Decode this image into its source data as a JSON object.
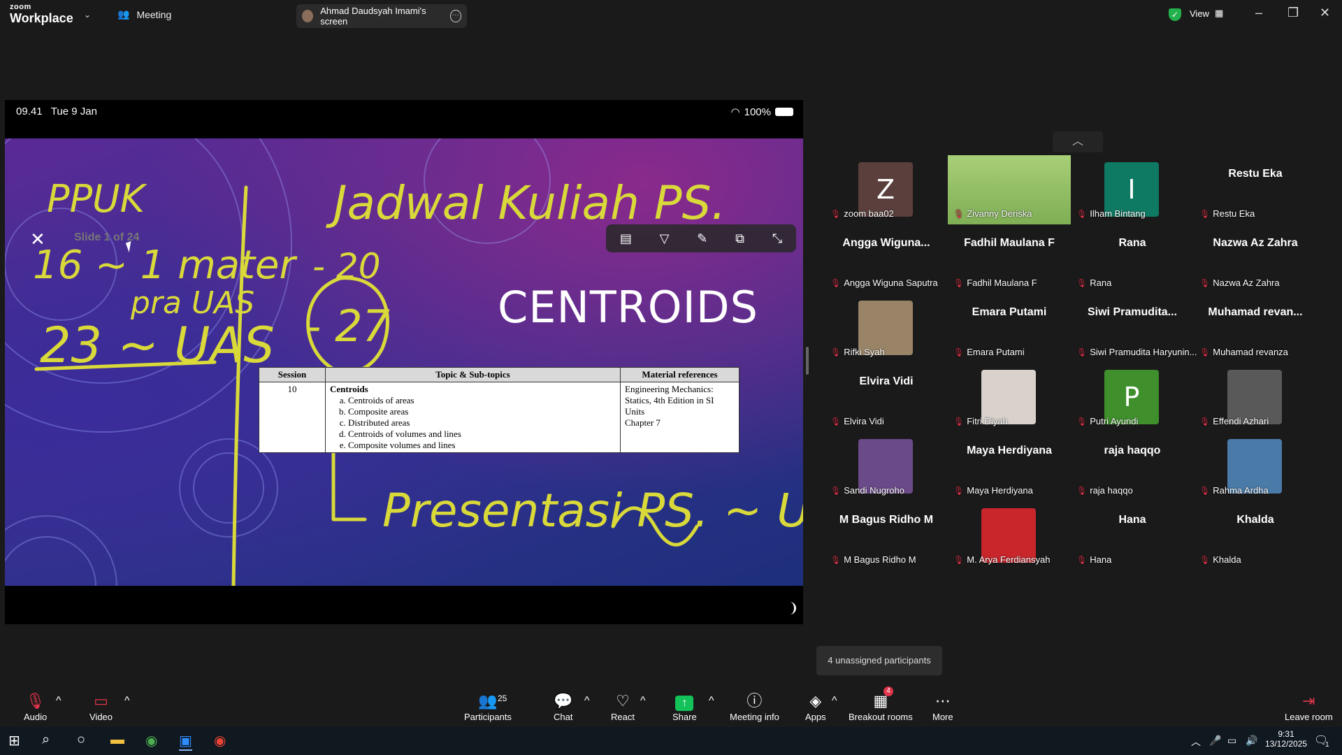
{
  "app": {
    "brand_line1": "zoom",
    "brand_line2": "Workplace",
    "meeting_tab": "Meeting",
    "screen_tab": "Ahmad Daudsyah Imami's screen",
    "view_label": "View"
  },
  "ipad": {
    "time": "09.41",
    "date": "Tue 9 Jan",
    "battery": "100%"
  },
  "slide": {
    "counter": "Slide 1 of 24",
    "title": "CENTROIDS",
    "table": {
      "headers": [
        "Session",
        "Topic & Sub-topics",
        "Material references"
      ],
      "session": "10",
      "topic": "Centroids",
      "subtopics": [
        "Centroids of areas",
        "Composite areas",
        "Distributed areas",
        "Centroids of volumes and lines",
        "Composite volumes and lines"
      ],
      "references": "Engineering Mechanics: Statics, 4th Edition in SI Units",
      "chapter": "Chapter 7"
    },
    "annotation_text": [
      "PPUK",
      "16 ~ 1 mater pra UAS",
      "23 ~ UAS",
      "Jadwal Kuliah PS.",
      "20",
      "27",
      "Presentasi PS. ~ UAS."
    ]
  },
  "participants": [
    {
      "display": "",
      "name": "zoom baa02",
      "letter": "Z",
      "color": "#5a3f3c",
      "kind": "letter"
    },
    {
      "display": "",
      "name": "Zivanny Deriska",
      "kind": "photo-wide",
      "color": "#7fae55"
    },
    {
      "display": "",
      "name": "Ilham Bintang",
      "letter": "I",
      "color": "#0f7a63",
      "kind": "letter"
    },
    {
      "display": "Restu Eka",
      "name": "Restu Eka",
      "kind": "text"
    },
    {
      "display": "Angga  Wiguna...",
      "name": "Angga Wiguna Saputra",
      "kind": "text"
    },
    {
      "display": "Fadhil Maulana F",
      "name": "Fadhil Maulana F",
      "kind": "text"
    },
    {
      "display": "Rana",
      "name": "Rana",
      "kind": "text"
    },
    {
      "display": "Nazwa Az Zahra",
      "name": "Nazwa Az Zahra",
      "kind": "text"
    },
    {
      "display": "",
      "name": "Rifki Syah",
      "kind": "photo",
      "color": "#9a8468"
    },
    {
      "display": "Emara Putami",
      "name": "Emara Putami",
      "kind": "text"
    },
    {
      "display": "Siwi  Pramudita...",
      "name": "Siwi Pramudita Haryunin...",
      "kind": "text"
    },
    {
      "display": "Muhamad  revan...",
      "name": "Muhamad revanza",
      "kind": "text"
    },
    {
      "display": "Elvira Vidi",
      "name": "Elvira Vidi",
      "kind": "text"
    },
    {
      "display": "",
      "name": "Fitri Diyah",
      "kind": "photo",
      "color": "#d9d2cc"
    },
    {
      "display": "",
      "name": "Putri Ayundi",
      "letter": "P",
      "color": "#3f8f2c",
      "kind": "letter"
    },
    {
      "display": "",
      "name": "Effendi Azhari",
      "kind": "photo",
      "color": "#595959"
    },
    {
      "display": "",
      "name": "Sandi Nugroho",
      "kind": "photo",
      "color": "#6b4a8a"
    },
    {
      "display": "Maya Herdiyana",
      "name": "Maya Herdiyana",
      "kind": "text"
    },
    {
      "display": "raja haqqo",
      "name": "raja haqqo",
      "kind": "text"
    },
    {
      "display": "",
      "name": "Rahma Ardha",
      "kind": "photo",
      "color": "#4a7aa8"
    },
    {
      "display": "M Bagus Ridho M",
      "name": "M Bagus Ridho M",
      "kind": "text"
    },
    {
      "display": "",
      "name": "M. Arya Ferdiansyah",
      "kind": "photo",
      "color": "#c8262b"
    },
    {
      "display": "Hana",
      "name": "Hana",
      "kind": "text"
    },
    {
      "display": "Khalda",
      "name": "Khalda",
      "kind": "text"
    }
  ],
  "unassigned": "4 unassigned participants",
  "toolbar": {
    "audio": "Audio",
    "video": "Video",
    "participants": "Participants",
    "participants_count": "25",
    "chat": "Chat",
    "react": "React",
    "share": "Share",
    "meeting_info": "Meeting info",
    "apps": "Apps",
    "breakout": "Breakout rooms",
    "breakout_badge": "4",
    "more": "More",
    "leave": "Leave room"
  },
  "taskbar": {
    "time": "9:31",
    "date": "13/12/2025",
    "notif": "1"
  }
}
